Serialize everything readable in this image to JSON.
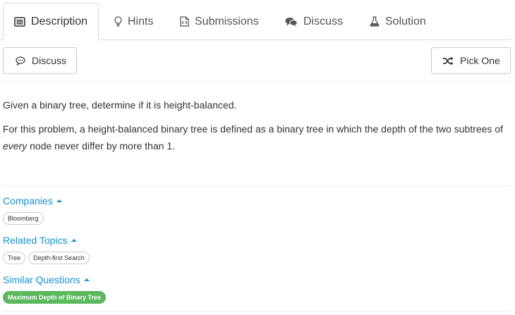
{
  "tabs": [
    {
      "label": "Description",
      "icon": "description-icon",
      "active": true
    },
    {
      "label": "Hints",
      "icon": "lightbulb-icon",
      "active": false
    },
    {
      "label": "Submissions",
      "icon": "code-file-icon",
      "active": false
    },
    {
      "label": "Discuss",
      "icon": "comments-icon",
      "active": false
    },
    {
      "label": "Solution",
      "icon": "flask-icon",
      "active": false
    }
  ],
  "toolbar": {
    "discuss_label": "Discuss",
    "pick_one_label": "Pick One"
  },
  "description": {
    "line1": "Given a binary tree, determine if it is height-balanced.",
    "line2_part1": "For this problem, a height-balanced binary tree is defined as a binary tree in which the depth of the two subtrees of ",
    "line2_emphasis": "every",
    "line2_part2": " node never differ by more than 1."
  },
  "sections": {
    "companies": {
      "title": "Companies",
      "tags": [
        "Bloomberg"
      ]
    },
    "related_topics": {
      "title": "Related Topics",
      "tags": [
        "Tree",
        "Depth-first Search"
      ]
    },
    "similar_questions": {
      "title": "Similar Questions",
      "tags": [
        "Maximum Depth of Binary Tree"
      ]
    }
  },
  "colors": {
    "link": "#1a90d2",
    "similar_tag_bg": "#5cb85c",
    "border": "#dddddd"
  }
}
